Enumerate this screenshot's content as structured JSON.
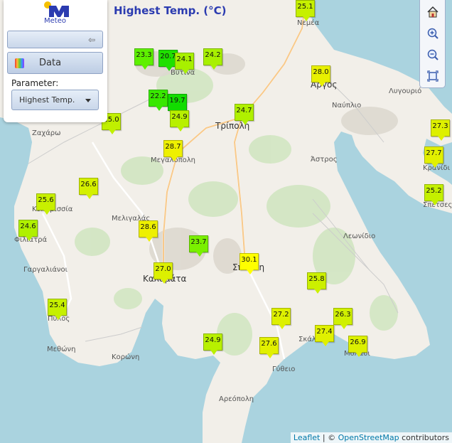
{
  "title": "Highest Temp. (°C)",
  "logo_text": "Meteo",
  "panel": {
    "data_label": "Data",
    "parameter_label": "Parameter:",
    "parameter_value": "Highest Temp."
  },
  "attribution": {
    "leaflet": "Leaflet",
    "separator": " | © ",
    "osm": "OpenStreetMap",
    "suffix": " contributors"
  },
  "places": [
    {
      "name": "Νεμέα",
      "big": false
    },
    {
      "name": "Βυτινα",
      "big": false
    },
    {
      "name": "Άργος",
      "big": true
    },
    {
      "name": "Λυγουριό",
      "big": false
    },
    {
      "name": "Ναύπλιο",
      "big": false
    },
    {
      "name": "Τρίπολη",
      "big": true
    },
    {
      "name": "Ζαχάρω",
      "big": false
    },
    {
      "name": "Μεγαλόπολη",
      "big": false
    },
    {
      "name": "Άστρος",
      "big": false
    },
    {
      "name": "Κρανίδι",
      "big": false
    },
    {
      "name": "Κυπαρισσία",
      "big": false
    },
    {
      "name": "Μελιγαλάς",
      "big": false
    },
    {
      "name": "Σπέτσες",
      "big": false
    },
    {
      "name": "Φιλιατρά",
      "big": false
    },
    {
      "name": "Λεωνίδιο",
      "big": false
    },
    {
      "name": "Σπάρτη",
      "big": true
    },
    {
      "name": "Γαργαλιάνοι",
      "big": false
    },
    {
      "name": "Καλαμάτα",
      "big": true
    },
    {
      "name": "Πύλος",
      "big": false
    },
    {
      "name": "Σκάλα",
      "big": false
    },
    {
      "name": "Μολάοι",
      "big": false
    },
    {
      "name": "Μεθώνη",
      "big": false
    },
    {
      "name": "Κορώνη",
      "big": false
    },
    {
      "name": "Γύθειο",
      "big": false
    },
    {
      "name": "Αρεόπολη",
      "big": false
    }
  ],
  "stations": [
    {
      "value": "25.1",
      "color": "#c6f000"
    },
    {
      "value": "23.3",
      "color": "#5ef000"
    },
    {
      "value": "20.7",
      "color": "#1fe000"
    },
    {
      "value": "24.1",
      "color": "#a8f000"
    },
    {
      "value": "24.2",
      "color": "#a8f000"
    },
    {
      "value": "28.0",
      "color": "#e8f000"
    },
    {
      "value": "22.2",
      "color": "#38e800"
    },
    {
      "value": "19.7",
      "color": "#12dc00"
    },
    {
      "value": "24.9",
      "color": "#b8f000"
    },
    {
      "value": "24.7",
      "color": "#b0f000"
    },
    {
      "value": "25.0",
      "color": "#c0f000"
    },
    {
      "value": "27.3",
      "color": "#def000"
    },
    {
      "value": "28.7",
      "color": "#eef000"
    },
    {
      "value": "27.7",
      "color": "#e2f000"
    },
    {
      "value": "26.6",
      "color": "#d4f000"
    },
    {
      "value": "25.2",
      "color": "#c4f000"
    },
    {
      "value": "25.6",
      "color": "#c8f000"
    },
    {
      "value": "24.6",
      "color": "#b0f000"
    },
    {
      "value": "28.6",
      "color": "#eef000"
    },
    {
      "value": "23.7",
      "color": "#7af000"
    },
    {
      "value": "30.1",
      "color": "#ffff00"
    },
    {
      "value": "27.0",
      "color": "#dcf000"
    },
    {
      "value": "25.8",
      "color": "#ccf000"
    },
    {
      "value": "25.4",
      "color": "#c6f000"
    },
    {
      "value": "27.2",
      "color": "#def000"
    },
    {
      "value": "26.3",
      "color": "#d0f000"
    },
    {
      "value": "27.4",
      "color": "#e0f000"
    },
    {
      "value": "24.9",
      "color": "#b8f000"
    },
    {
      "value": "27.6",
      "color": "#e2f000"
    },
    {
      "value": "26.9",
      "color": "#dcf000"
    }
  ]
}
